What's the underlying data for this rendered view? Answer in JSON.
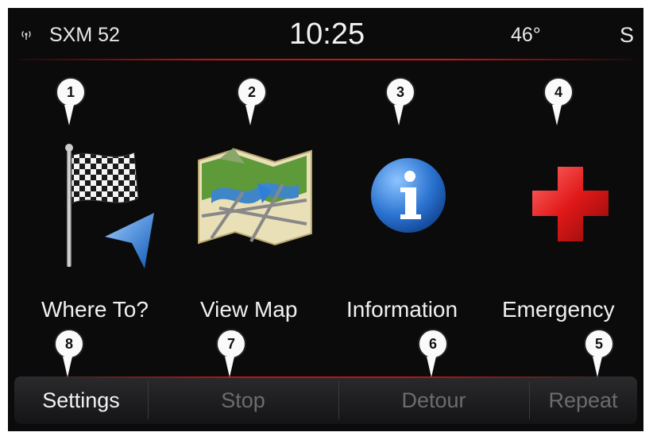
{
  "status_bar": {
    "signal_icon": "radio-signal-icon",
    "station": "SXM 52",
    "time": "10:25",
    "temperature": "46°",
    "compass": "S"
  },
  "menu": [
    {
      "label": "Where To?",
      "icon": "checkered-flag-icon",
      "callout": "1"
    },
    {
      "label": "View Map",
      "icon": "map-icon",
      "callout": "2"
    },
    {
      "label": "Information",
      "icon": "info-icon",
      "callout": "3"
    },
    {
      "label": "Emergency",
      "icon": "red-cross-icon",
      "callout": "4"
    }
  ],
  "bottom_bar": {
    "settings": {
      "label": "Settings",
      "callout": "8"
    },
    "stop": {
      "label": "Stop",
      "callout": "7"
    },
    "detour": {
      "label": "Detour",
      "callout": "6"
    },
    "repeat": {
      "label": "Repeat",
      "callout": "5"
    }
  },
  "colors": {
    "accent_red": "#c01414",
    "background": "#0b0b0c",
    "active_text": "#f2f2f2",
    "inactive_text": "#6c6c6c"
  }
}
